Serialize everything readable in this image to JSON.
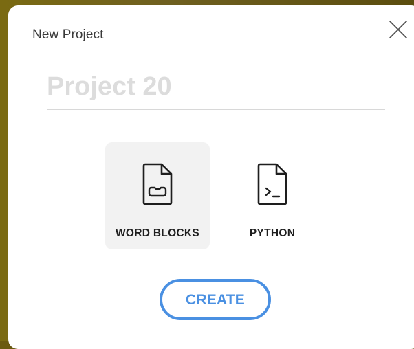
{
  "dialog": {
    "title": "New Project",
    "close_icon": "close-icon"
  },
  "project_name": {
    "placeholder": "Project 20",
    "value": ""
  },
  "project_types": [
    {
      "label": "WORD BLOCKS",
      "icon": "word-blocks-file-icon",
      "selected": true
    },
    {
      "label": "PYTHON",
      "icon": "python-file-icon",
      "selected": false
    }
  ],
  "actions": {
    "create_label": "CREATE"
  },
  "colors": {
    "accent": "#4a90e2",
    "selected_bg": "#f2f2f2",
    "placeholder_text": "#dcdcdc"
  }
}
